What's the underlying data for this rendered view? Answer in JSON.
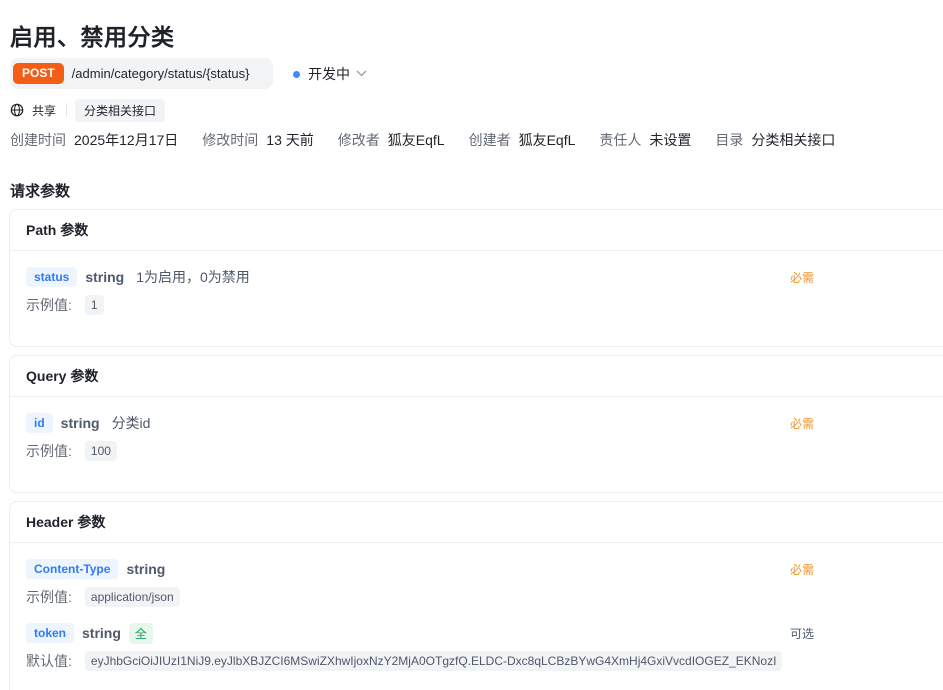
{
  "page": {
    "title": "启用、禁用分类",
    "method": "POST",
    "path": "/admin/category/status/{status}",
    "status": "开发中",
    "share_label": "共享",
    "directory_tag": "分类相关接口"
  },
  "meta": [
    {
      "key": "创建时间",
      "value": "2025年12月17日"
    },
    {
      "key": "修改时间",
      "value": "13 天前"
    },
    {
      "key": "修改者",
      "value": "狐友EqfL"
    },
    {
      "key": "创建者",
      "value": "狐友EqfL"
    },
    {
      "key": "责任人",
      "value": "未设置"
    },
    {
      "key": "目录",
      "value": "分类相关接口"
    }
  ],
  "request_params_title": "请求参数",
  "path_section": {
    "title": "Path 参数",
    "params": [
      {
        "name": "status",
        "type": "string",
        "desc": "1为启用，0为禁用",
        "required": "必需",
        "example_label": "示例值:",
        "example": "1"
      }
    ]
  },
  "query_section": {
    "title": "Query 参数",
    "params": [
      {
        "name": "id",
        "type": "string",
        "desc": "分类id",
        "required": "必需",
        "example_label": "示例值:",
        "example": "100"
      }
    ]
  },
  "header_section": {
    "title": "Header 参数",
    "params": [
      {
        "name": "Content-Type",
        "type": "string",
        "required": "必需",
        "example_label": "示例值:",
        "example": "application/json"
      },
      {
        "name": "token",
        "type": "string",
        "badge": "全",
        "required": "可选",
        "default_label": "默认值:",
        "default": "eyJhbGciOiJIUzI1NiJ9.eyJlbXBJZCI6MSwiZXhwIjoxNzY2MjA0OTgzfQ.ELDC-Dxc8qLCBzBYwG4XmHj4GxiVvcdIOGEZ_EKNozI"
      }
    ]
  },
  "colors": {
    "method_badge": "#f35d15",
    "status_dot": "#3c8cff",
    "required": "#f0932b",
    "param_name": "#2f7bf5"
  }
}
